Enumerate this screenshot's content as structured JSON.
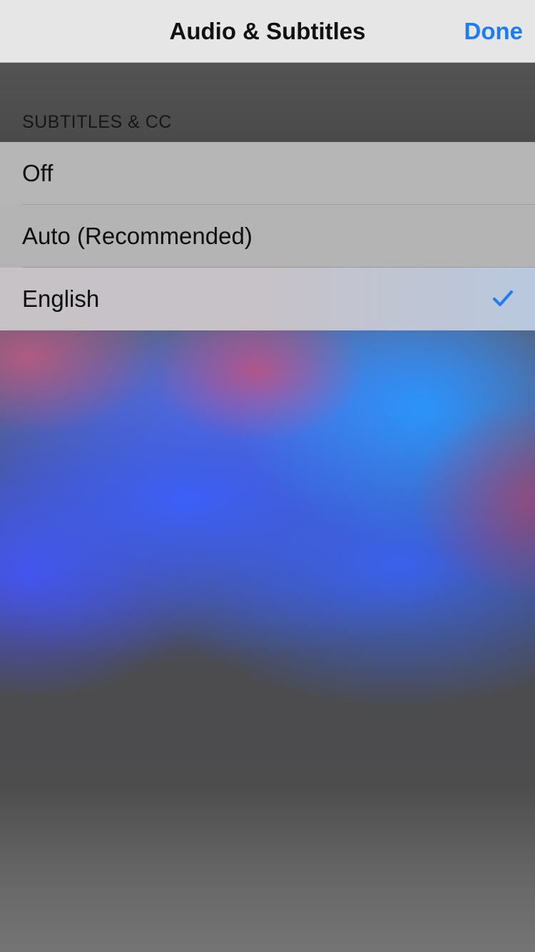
{
  "header": {
    "title": "Audio & Subtitles",
    "done_label": "Done"
  },
  "section": {
    "header": "SUBTITLES & CC"
  },
  "options": [
    {
      "label": "Off",
      "selected": false
    },
    {
      "label": "Auto (Recommended)",
      "selected": false
    },
    {
      "label": "English",
      "selected": true
    }
  ],
  "colors": {
    "accent": "#1e7cf2",
    "nav_background": "#e6e6e6",
    "row_background": "#b6b6b6"
  },
  "icons": {
    "selected": "checkmark-icon"
  }
}
